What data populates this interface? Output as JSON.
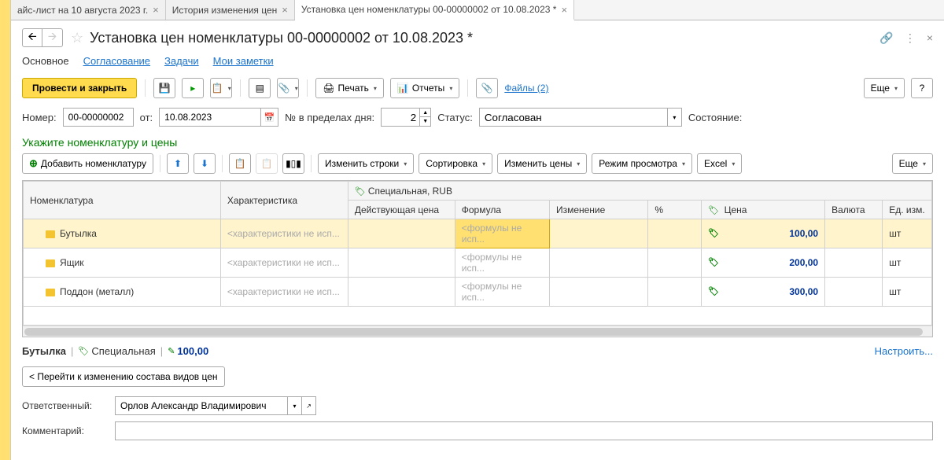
{
  "tabs": [
    {
      "label": "айс-лист на 10 августа 2023 г."
    },
    {
      "label": "История изменения цен"
    },
    {
      "label": "Установка цен номенклатуры 00-00000002 от 10.08.2023 *",
      "active": true
    }
  ],
  "header": {
    "title": "Установка цен номенклатуры 00-00000002 от 10.08.2023 *"
  },
  "subtabs": {
    "main": "Основное",
    "approval": "Согласование",
    "tasks": "Задачи",
    "notes": "Мои заметки"
  },
  "toolbar": {
    "post_close": "Провести и закрыть",
    "print": "Печать",
    "reports": "Отчеты",
    "files": "Файлы (2)",
    "more": "Еще",
    "help": "?"
  },
  "form": {
    "number_label": "Номер:",
    "number_value": "00-00000002",
    "from_label": "от:",
    "date_value": "10.08.2023",
    "within_day_label": "№ в пределах дня:",
    "within_day_value": "2",
    "status_label": "Статус:",
    "status_value": "Согласован",
    "state_label": "Состояние:"
  },
  "section": {
    "heading": "Укажите номенклатуру и цены"
  },
  "table_toolbar": {
    "add": "Добавить номенклатуру",
    "change_rows": "Изменить строки",
    "sort": "Сортировка",
    "change_prices": "Изменить цены",
    "view_mode": "Режим просмотра",
    "excel": "Excel",
    "more": "Еще"
  },
  "table": {
    "headers": {
      "nomenclature": "Номенклатура",
      "characteristic": "Характеристика",
      "special_group": "Специальная, RUB",
      "current_price": "Действующая цена",
      "formula": "Формула",
      "change": "Изменение",
      "percent": "%",
      "price": "Цена",
      "currency": "Валюта",
      "unit": "Ед. изм."
    },
    "char_placeholder": "<характеристики не исп...",
    "formula_placeholder": "<формулы не исп...",
    "rows": [
      {
        "name": "Бутылка",
        "price": "100,00",
        "currency": "",
        "unit": "шт",
        "selected": true
      },
      {
        "name": "Ящик",
        "price": "200,00",
        "currency": "",
        "unit": "шт"
      },
      {
        "name": "Поддон (металл)",
        "price": "300,00",
        "currency": "",
        "unit": "шт"
      }
    ]
  },
  "bottom": {
    "item_name": "Бутылка",
    "price_type": "Специальная",
    "price_value": "100,00",
    "configure": "Настроить...",
    "change_types_btn": "< Перейти к изменению состава видов цен",
    "responsible_label": "Ответственный:",
    "responsible_value": "Орлов Александр Владимирович",
    "comment_label": "Комментарий:"
  }
}
